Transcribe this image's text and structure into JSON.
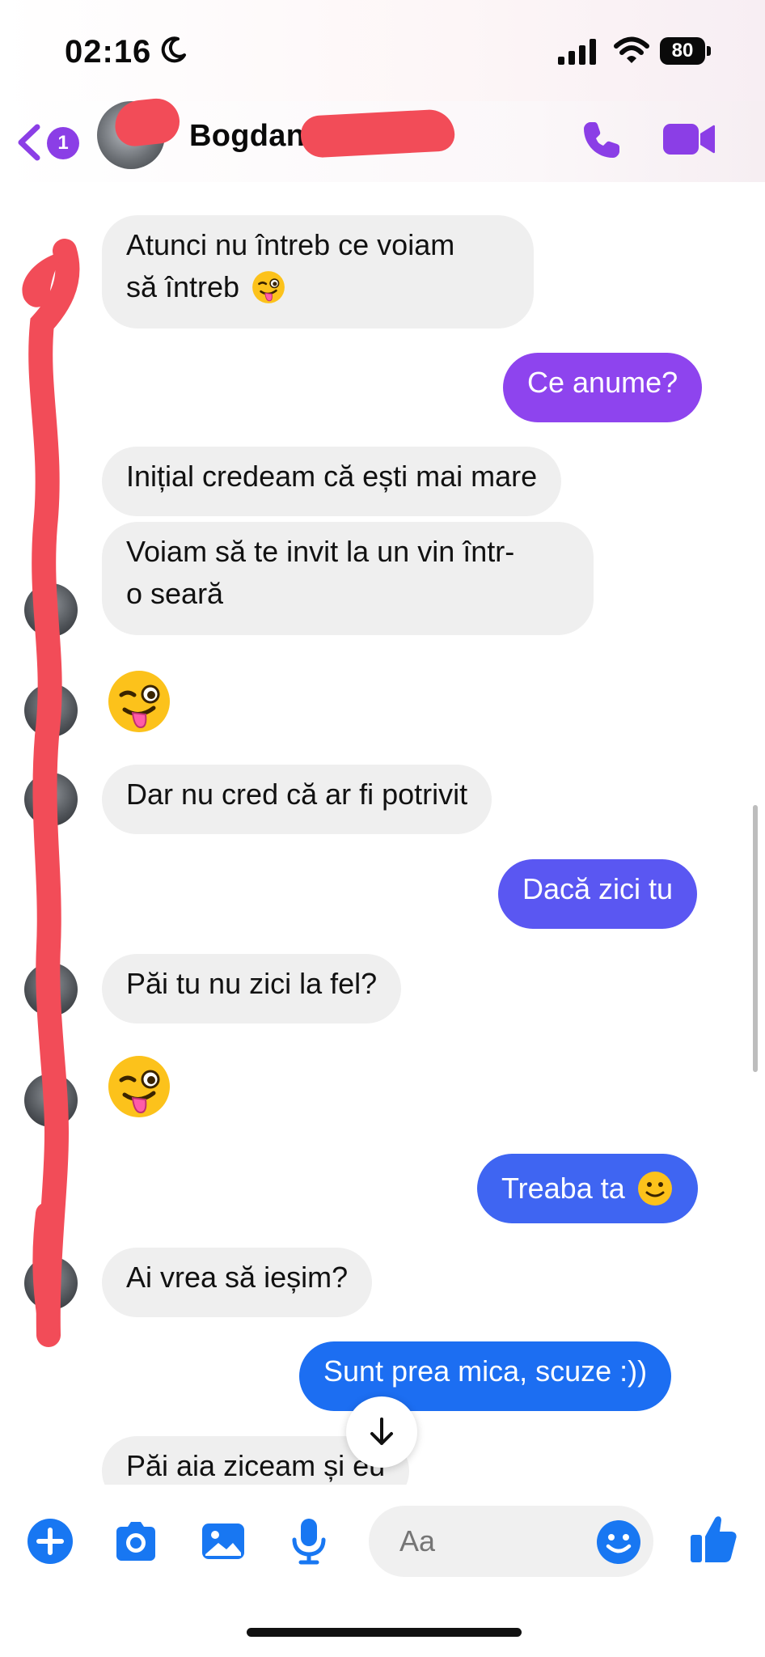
{
  "status_bar": {
    "time": "02:16",
    "battery": "80"
  },
  "header": {
    "unread_count": "1",
    "contact_name": "Bogdan"
  },
  "colors": {
    "accent_purple": "#8b3ee6",
    "messenger_blue": "#1877f2",
    "redaction_red": "#f24c58",
    "incoming_bubble": "#efefef"
  },
  "icons": [
    "back-chevron-icon",
    "phone-icon",
    "video-camera-icon",
    "wink-emoji-icon",
    "arrow-down-icon",
    "plus-icon",
    "camera-icon",
    "gallery-icon",
    "microphone-icon",
    "smiley-icon",
    "thumbs-up-icon"
  ],
  "messages": [
    {
      "from": "them",
      "line1": "Atunci nu întreb ce voiam",
      "line2": "să întreb"
    },
    {
      "from": "me",
      "text": "Ce anume?"
    },
    {
      "from": "them",
      "text": "Inițial credeam că ești mai mare"
    },
    {
      "from": "them",
      "line1": "Voiam să te invit la un vin într-",
      "line2": "o seară"
    },
    {
      "from": "them",
      "emoji": "wink"
    },
    {
      "from": "them",
      "text": "Dar nu cred că ar fi potrivit"
    },
    {
      "from": "me",
      "text": "Dacă zici tu"
    },
    {
      "from": "them",
      "text": "Păi tu nu zici la fel?"
    },
    {
      "from": "them",
      "emoji": "wink"
    },
    {
      "from": "me",
      "text": "Treaba ta"
    },
    {
      "from": "them",
      "text": "Ai vrea să ieșim?"
    },
    {
      "from": "me",
      "text": "Sunt prea mica, scuze :))"
    },
    {
      "from": "them",
      "text": "Păi aia ziceam și eu"
    }
  ],
  "composer": {
    "placeholder": "Aa"
  }
}
